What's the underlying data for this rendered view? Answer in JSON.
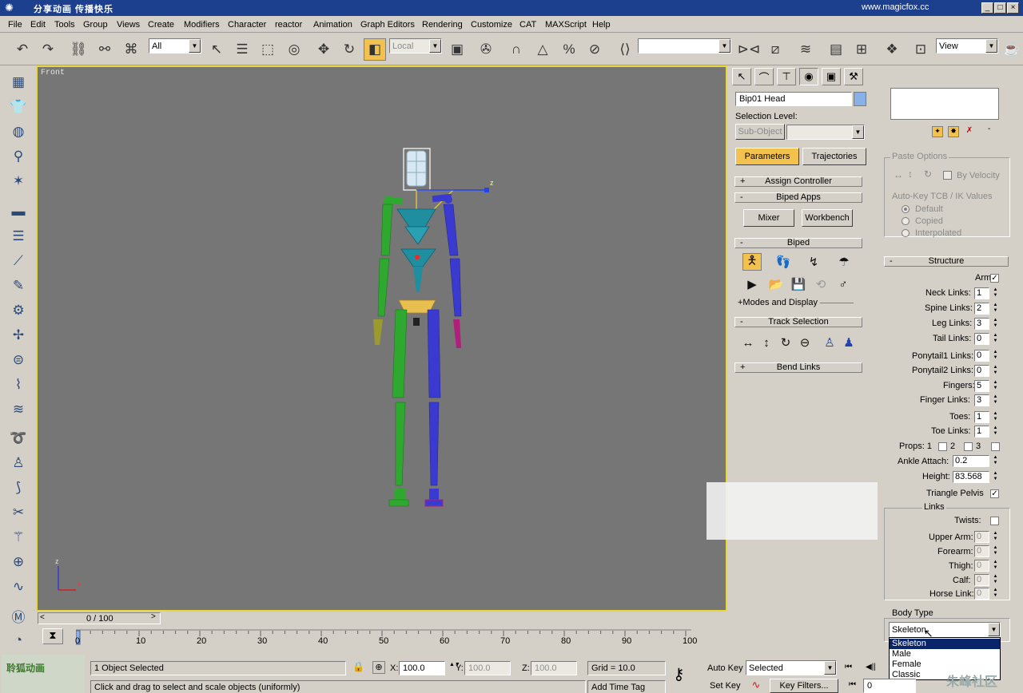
{
  "app": {
    "title": "分享动画    传播快乐",
    "url": "www.magicfox.cc",
    "window_buttons": [
      "_",
      "□",
      "×"
    ]
  },
  "menu": [
    "File",
    "Edit",
    "Tools",
    "Group",
    "Views",
    "Create",
    "Modifiers",
    "Character",
    "reactor",
    "Animation",
    "Graph Editors",
    "Rendering",
    "Customize",
    "CAT",
    "MAXScript",
    "Help"
  ],
  "toolbar": {
    "selection_filter": "All",
    "coord_system": "Local",
    "named_selection": "",
    "render_type": "View"
  },
  "viewport": {
    "label": "Front",
    "axis_z": "z",
    "axis_x": "x",
    "gizmo_z": "z"
  },
  "command_panel": {
    "object_name": "Bip01 Head",
    "selection_level_label": "Selection Level:",
    "sub_object_label": "Sub-Object",
    "tab_parameters": "Parameters",
    "tab_trajectories": "Trajectories",
    "rollouts": {
      "assign_controller": "Assign Controller",
      "biped_apps": "Biped Apps",
      "mixer": "Mixer",
      "workbench": "Workbench",
      "biped": "Biped",
      "modes_display": "+Modes and Display",
      "track_selection": "Track Selection",
      "bend_links": "Bend Links"
    }
  },
  "right_panel": {
    "paste_options": "Paste Options",
    "by_velocity": "By Velocity",
    "autokey_title": "Auto-Key TCB / IK Values",
    "radio_default": "Default",
    "radio_copied": "Copied",
    "radio_interpolated": "Interpolated",
    "structure_title": "Structure",
    "arms": "Arms",
    "neck_links": {
      "label": "Neck Links:",
      "value": "1"
    },
    "spine_links": {
      "label": "Spine Links:",
      "value": "2"
    },
    "leg_links": {
      "label": "Leg Links:",
      "value": "3"
    },
    "tail_links": {
      "label": "Tail Links:",
      "value": "0"
    },
    "ponytail1": {
      "label": "Ponytail1 Links:",
      "value": "0"
    },
    "ponytail2": {
      "label": "Ponytail2 Links:",
      "value": "0"
    },
    "fingers": {
      "label": "Fingers:",
      "value": "5"
    },
    "finger_links": {
      "label": "Finger Links:",
      "value": "3"
    },
    "toes": {
      "label": "Toes:",
      "value": "1"
    },
    "toe_links": {
      "label": "Toe Links:",
      "value": "1"
    },
    "props_label": "Props: 1",
    "props_2": "2",
    "props_3": "3",
    "ankle_attach": {
      "label": "Ankle Attach:",
      "value": "0.2"
    },
    "height": {
      "label": "Height:",
      "value": "83.568"
    },
    "triangle_pelvis": "Triangle Pelvis",
    "links_title": "Links",
    "twists": "Twists:",
    "upper_arm": {
      "label": "Upper Arm:",
      "value": "0"
    },
    "forearm": {
      "label": "Forearm:",
      "value": "0"
    },
    "thigh": {
      "label": "Thigh:",
      "value": "0"
    },
    "calf": {
      "label": "Calf:",
      "value": "0"
    },
    "horse_link": {
      "label": "Horse Link:",
      "value": "0"
    },
    "body_type_title": "Body Type",
    "body_type_value": "Skeleton",
    "body_type_options": [
      "Skeleton",
      "Male",
      "Female",
      "Classic"
    ]
  },
  "timeline": {
    "frame_counter": "0 / 100",
    "ticks": [
      "0",
      "10",
      "20",
      "30",
      "40",
      "50",
      "60",
      "70",
      "80",
      "90",
      "100"
    ]
  },
  "status": {
    "objects_selected": "1 Object Selected",
    "prompt": "Click and drag to select and scale objects (uniformly)",
    "x_label": "X:",
    "x_value": "100.0",
    "y_label": "Y:",
    "y_value": "100.0",
    "z_label": "Z:",
    "z_value": "100.0",
    "grid": "Grid = 10.0",
    "auto_key": "Auto Key",
    "set_key": "Set Key",
    "key_mode": "Selected",
    "key_filters": "Key Filters...",
    "add_time_tag": "Add Time Tag",
    "current_frame": "0",
    "watermark_left": "聆狐动画",
    "watermark_right": "朱峰社区"
  },
  "colors": {
    "active_border": "#e8d838",
    "viewport_bg": "#767676",
    "highlight": "#f2c14e",
    "title_bar": "#1c3f8e",
    "dropdown_sel": "#0a246a"
  }
}
